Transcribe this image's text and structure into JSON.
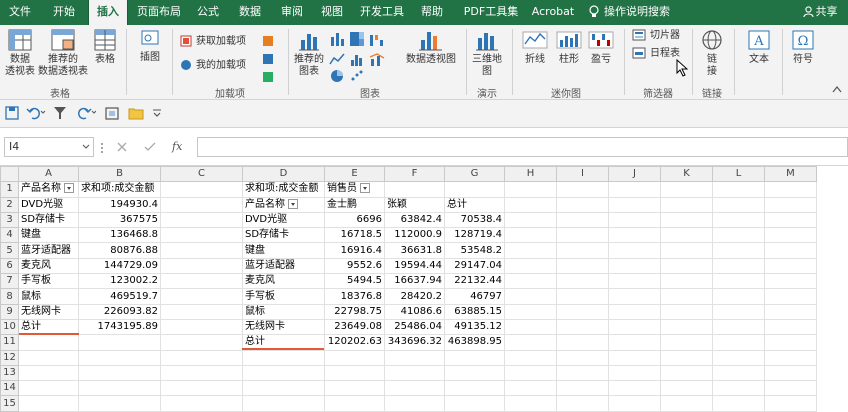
{
  "menu": {
    "tabs": [
      "文件",
      "开始",
      "插入",
      "页面布局",
      "公式",
      "数据",
      "审阅",
      "视图",
      "开发工具",
      "帮助",
      "PDF工具集",
      "Acrobat"
    ],
    "active": "插入",
    "search": "操作说明搜索",
    "share": "共享"
  },
  "ribbon": {
    "pivot": "数据\n透视表",
    "recommended_pivot": "推荐的\n数据透视表",
    "table": "表格",
    "group_tables": "表格",
    "illustrations": "插图",
    "get_addins": "获取加载项",
    "my_addins": "我的加载项",
    "group_addins": "加载项",
    "recommended_charts": "推荐的\n图表",
    "pivot_chart": "数据透视图",
    "group_charts": "图表",
    "map_3d": "三维地\n图",
    "group_tours": "演示",
    "spark_line": "折线",
    "spark_column": "柱形",
    "spark_winloss": "盈亏",
    "group_sparklines": "迷你图",
    "slicer": "切片器",
    "timeline": "日程表",
    "group_filters": "筛选器",
    "link": "链\n接",
    "group_links": "链接",
    "text": "文本",
    "symbol": "符号"
  },
  "formula_bar": {
    "name_box": "I4",
    "fx": "fx",
    "formula": ""
  },
  "sheet": {
    "columns": [
      "A",
      "B",
      "C",
      "D",
      "E",
      "F",
      "G",
      "H",
      "I",
      "J",
      "K",
      "L",
      "M"
    ],
    "rows": [
      [
        "产品名称",
        "求和项:成交金额",
        "",
        "求和项:成交金额",
        "销售员",
        "",
        "",
        "",
        "",
        "",
        "",
        "",
        ""
      ],
      [
        "DVD光驱",
        "194930.4",
        "",
        "产品名称",
        "金士鹏",
        "张颖",
        "总计",
        "",
        "",
        "",
        "",
        "",
        ""
      ],
      [
        "SD存储卡",
        "367575",
        "",
        "DVD光驱",
        "6696",
        "63842.4",
        "70538.4",
        "",
        "",
        "",
        "",
        "",
        ""
      ],
      [
        "键盘",
        "136468.8",
        "",
        "SD存储卡",
        "16718.5",
        "112000.9",
        "128719.4",
        "",
        "",
        "",
        "",
        "",
        ""
      ],
      [
        "蓝牙适配器",
        "80876.88",
        "",
        "键盘",
        "16916.4",
        "36631.8",
        "53548.2",
        "",
        "",
        "",
        "",
        "",
        ""
      ],
      [
        "麦克风",
        "144729.09",
        "",
        "蓝牙适配器",
        "9552.6",
        "19594.44",
        "29147.04",
        "",
        "",
        "",
        "",
        "",
        ""
      ],
      [
        "手写板",
        "123002.2",
        "",
        "麦克风",
        "5494.5",
        "16637.94",
        "22132.44",
        "",
        "",
        "",
        "",
        "",
        ""
      ],
      [
        "鼠标",
        "469519.7",
        "",
        "手写板",
        "18376.8",
        "28420.2",
        "46797",
        "",
        "",
        "",
        "",
        "",
        ""
      ],
      [
        "无线网卡",
        "226093.82",
        "",
        "鼠标",
        "22798.75",
        "41086.6",
        "63885.15",
        "",
        "",
        "",
        "",
        "",
        ""
      ],
      [
        "总计",
        "1743195.89",
        "",
        "无线网卡",
        "23649.08",
        "25486.04",
        "49135.12",
        "",
        "",
        "",
        "",
        "",
        ""
      ],
      [
        "",
        "",
        "",
        "总计",
        "120202.63",
        "343696.32",
        "463898.95",
        "",
        "",
        "",
        "",
        "",
        ""
      ],
      [
        "",
        "",
        "",
        "",
        "",
        "",
        "",
        "",
        "",
        "",
        "",
        "",
        ""
      ],
      [
        "",
        "",
        "",
        "",
        "",
        "",
        "",
        "",
        "",
        "",
        "",
        "",
        ""
      ],
      [
        "",
        "",
        "",
        "",
        "",
        "",
        "",
        "",
        "",
        "",
        "",
        "",
        ""
      ],
      [
        "",
        "",
        "",
        "",
        "",
        "",
        "",
        "",
        "",
        "",
        "",
        "",
        ""
      ]
    ]
  }
}
